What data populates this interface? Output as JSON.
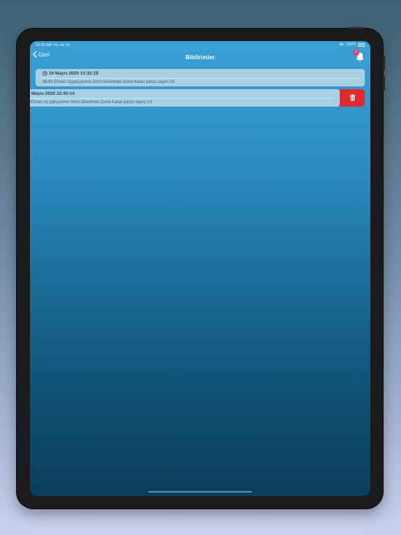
{
  "statusbar": {
    "time": "10:35 AM",
    "date": "Fri Jul 24",
    "battery": "100%"
  },
  "navbar": {
    "back_label": "Geri",
    "title": "Bildirimler",
    "badge_count": "2"
  },
  "notifications": [
    {
      "date": "19 Mayıs 2020 13:32:15",
      "message": "ML60 Elmas Uçparçasının ömrü tükenmek üzere Kalan parça sayısı 13"
    },
    {
      "date": "Mayıs 2020 22:45:14",
      "message": "Elmas Uç parçasının ömrü tükenmek üzere Kalan parça sayısı 13"
    }
  ],
  "colors": {
    "delete": "#e0282f",
    "badge": "#e63a6a",
    "card": "#a8cfe3"
  }
}
